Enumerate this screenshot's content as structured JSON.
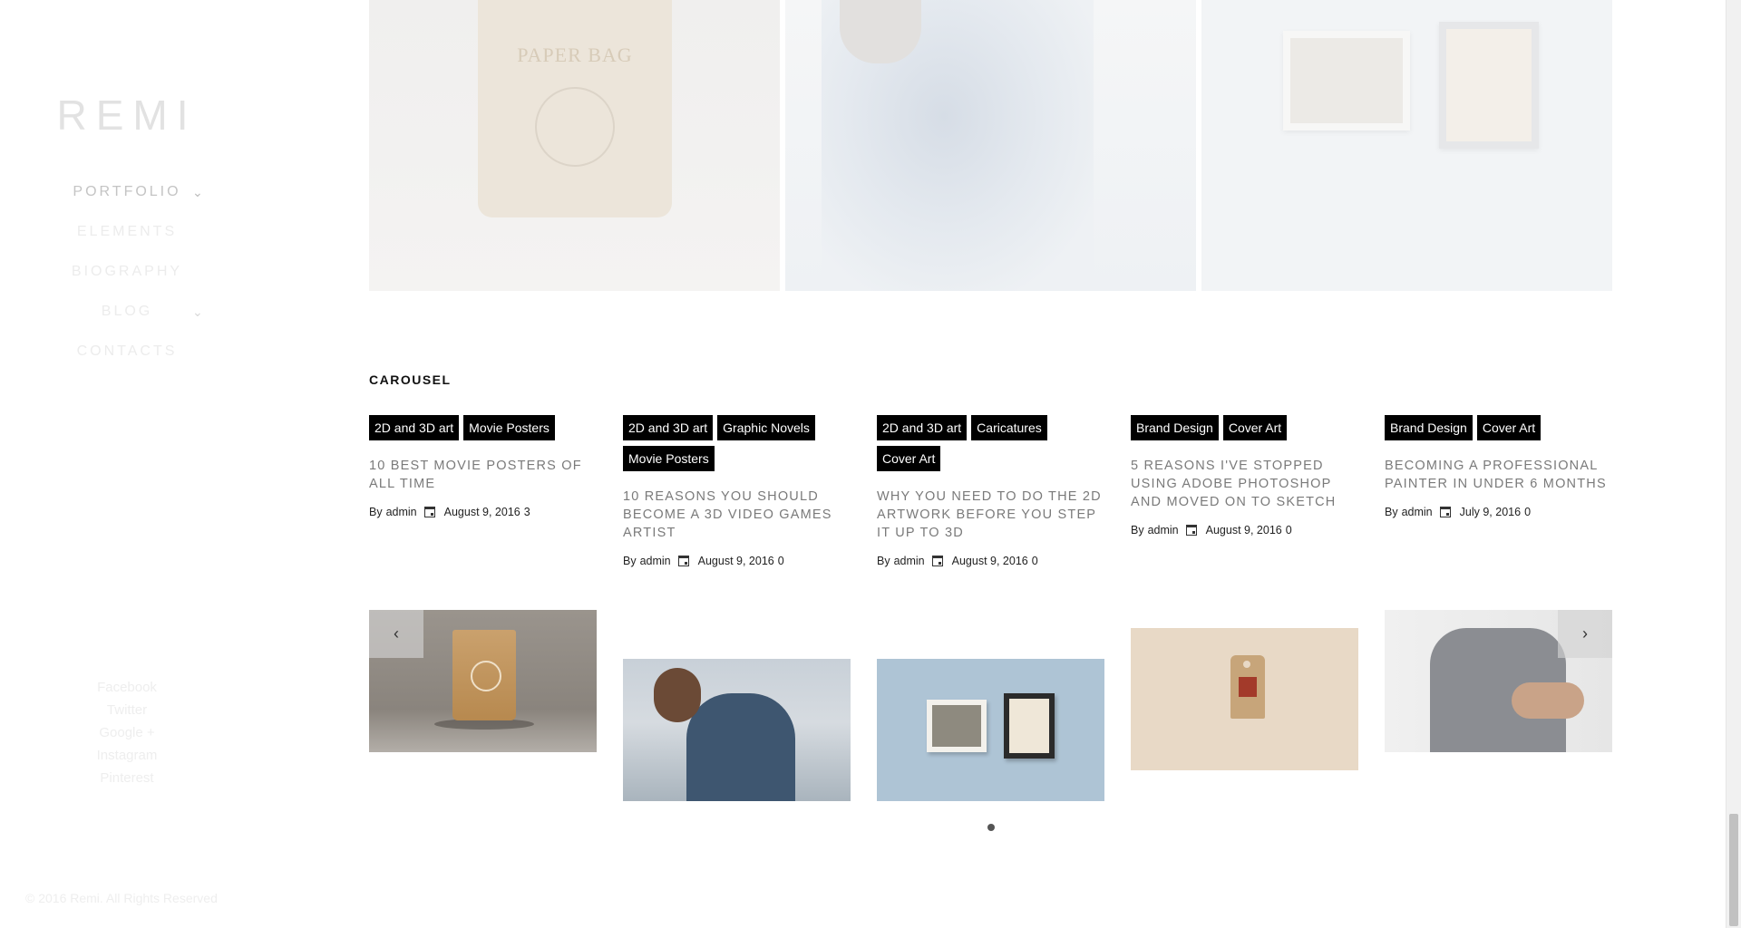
{
  "brand": {
    "logo": "REMI"
  },
  "nav": {
    "items": [
      {
        "label": "PORTFOLIO",
        "has_submenu": true,
        "active": true
      },
      {
        "label": "ELEMENTS",
        "has_submenu": false
      },
      {
        "label": "BIOGRAPHY",
        "has_submenu": false
      },
      {
        "label": "BLOG",
        "has_submenu": true
      },
      {
        "label": "CONTACTS",
        "has_submenu": false
      }
    ],
    "chevron": "⌄"
  },
  "social": [
    "Facebook",
    "Twitter",
    "Google +",
    "Instagram",
    "Pinterest"
  ],
  "footer": {
    "copyright": "© 2016 Remi. All Rights Reserved"
  },
  "gallery_top": {
    "tiles": [
      {
        "icon": "paper-bag-photo",
        "text": "PAPER BAG"
      },
      {
        "icon": "bearded-man-photo"
      },
      {
        "icon": "framed-art-photo"
      }
    ]
  },
  "carousel": {
    "heading": "CAROUSEL",
    "prev_label": "‹",
    "next_label": "›",
    "posts": [
      {
        "tags": [
          "2D and 3D art",
          "Movie Posters"
        ],
        "title": "10 Best Movie Posters of All Time",
        "by": "By",
        "author": "admin",
        "date": "August 9, 2016",
        "comments": "3",
        "image": "paper-bag-product-photo"
      },
      {
        "tags": [
          "2D and 3D art",
          "Graphic Novels",
          "Movie Posters"
        ],
        "title": "10 Reasons You Should Become a 3D Video Games Artist",
        "by": "By",
        "author": "admin",
        "date": "August 9, 2016",
        "comments": "0",
        "image": "bearded-man-photo"
      },
      {
        "tags": [
          "2D and 3D art",
          "Caricatures",
          "Cover Art"
        ],
        "title": "Why You Need to Do the 2D Artwork Before You Step It Up to 3D",
        "by": "By",
        "author": "admin",
        "date": "August 9, 2016",
        "comments": "0",
        "image": "framed-art-photo"
      },
      {
        "tags": [
          "Brand Design",
          "Cover Art"
        ],
        "title": "5 Reasons I've Stopped Using Adobe Photoshop and Moved on to Sketch",
        "by": "By",
        "author": "admin",
        "date": "August 9, 2016",
        "comments": "0",
        "image": "hang-tag-photo"
      },
      {
        "tags": [
          "Brand Design",
          "Cover Art"
        ],
        "title": "Becoming a Professional Painter in Under 6 Months",
        "by": "By",
        "author": "admin",
        "date": "July 9, 2016",
        "comments": "0",
        "image": "tattooed-arm-photo"
      }
    ]
  },
  "colors": {
    "tag_bg": "#000000",
    "tag_text": "#ffffff",
    "title_text": "#7a7a7a",
    "nav_faded": "#ececec"
  }
}
